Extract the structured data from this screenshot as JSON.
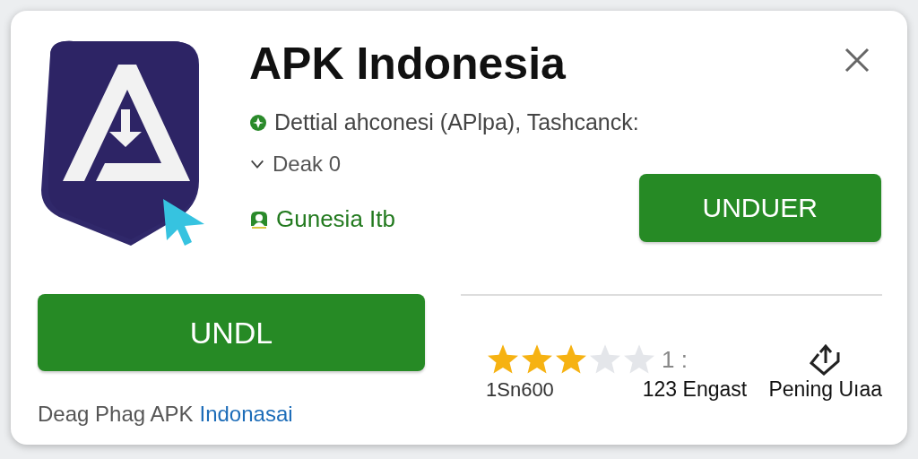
{
  "app": {
    "title": "APK Indonesia",
    "subtitle": "Dettial ahconesi (APlpa),  Tashcanck:",
    "detail": "Deak 0",
    "publisher": "Gunesia Itb"
  },
  "install_button": {
    "label": "UNDUER"
  },
  "download_button": {
    "label": "UNDL"
  },
  "footer": {
    "text": "Deag Phag APK",
    "link": "Indonasai"
  },
  "rating": {
    "stars": 3,
    "count": "1 :",
    "caption": "1Sn600"
  },
  "stats": [
    {
      "kind": "text",
      "label": "123 Engast"
    },
    {
      "kind": "share",
      "label": "Pening Uıaa"
    }
  ]
}
